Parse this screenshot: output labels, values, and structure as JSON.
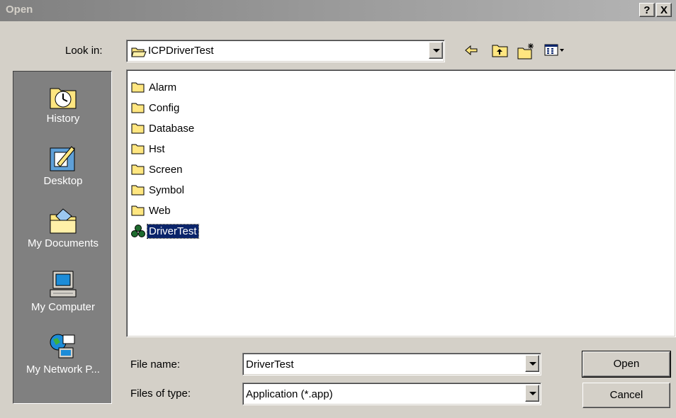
{
  "window": {
    "title": "Open",
    "help_label": "?",
    "close_label": "X"
  },
  "look_in": {
    "label": "Look in:",
    "value": "ICPDriverTest"
  },
  "toolbar": {
    "icons": [
      "back-arrow-icon",
      "up-folder-icon",
      "new-folder-icon",
      "view-menu-icon"
    ]
  },
  "places": [
    {
      "label": "History",
      "icon": "history-icon"
    },
    {
      "label": "Desktop",
      "icon": "desktop-icon"
    },
    {
      "label": "My Documents",
      "icon": "my-documents-icon"
    },
    {
      "label": "My Computer",
      "icon": "my-computer-icon"
    },
    {
      "label": "My Network P...",
      "icon": "network-places-icon"
    }
  ],
  "files": [
    {
      "name": "Alarm",
      "type": "folder"
    },
    {
      "name": "Config",
      "type": "folder"
    },
    {
      "name": "Database",
      "type": "folder"
    },
    {
      "name": "Hst",
      "type": "folder"
    },
    {
      "name": "Screen",
      "type": "folder"
    },
    {
      "name": "Symbol",
      "type": "folder"
    },
    {
      "name": "Web",
      "type": "folder"
    },
    {
      "name": "DriverTest",
      "type": "application",
      "selected": true
    }
  ],
  "file_name": {
    "label": "File name:",
    "value": "DriverTest"
  },
  "file_type": {
    "label": "Files of type:",
    "value": "Application (*.app)"
  },
  "buttons": {
    "open": "Open",
    "cancel": "Cancel"
  },
  "colors": {
    "face": "#d4d0c8",
    "selection": "#0a246a",
    "places_bg": "#808080",
    "folder": "#ffe680"
  }
}
